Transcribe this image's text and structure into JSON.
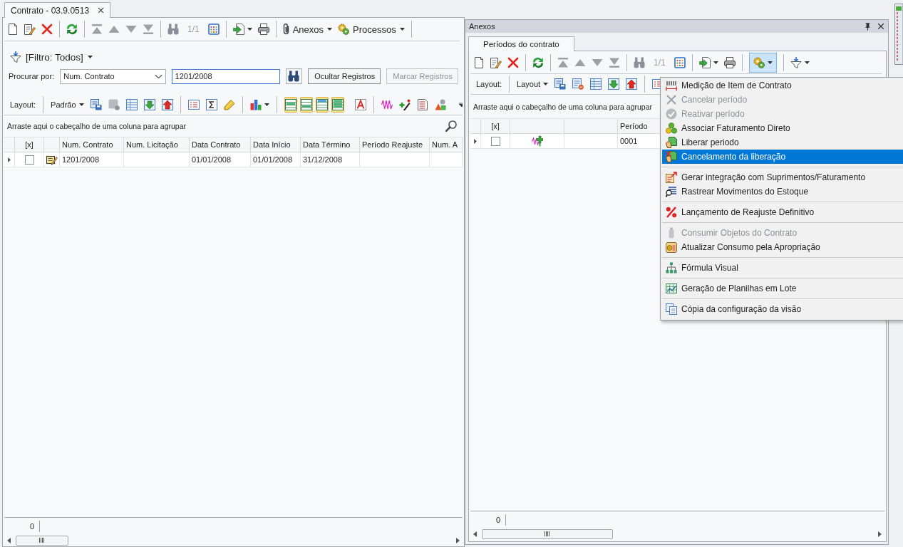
{
  "document_tab": {
    "title": "Contrato - 03.9.0513",
    "selected": true
  },
  "main": {
    "toolbar": {
      "record_counter": "1/1",
      "menus": [
        {
          "label": "Anexos"
        },
        {
          "label": "Processos"
        }
      ]
    },
    "filter": {
      "label": "[Filtro: Todos]"
    },
    "search": {
      "label": "Procurar por:",
      "field": "Num. Contrato",
      "query": "1201/2008",
      "buttons": [
        {
          "label": "Ocultar Registros",
          "disabled": false
        },
        {
          "label": "Marcar Registros",
          "disabled": true
        }
      ]
    },
    "layout_toolbar": {
      "label": "Layout:",
      "preset": "Padrão",
      "toggles": [
        {
          "on": true
        },
        {
          "on": true
        },
        {
          "on": true
        },
        {
          "on": true
        }
      ]
    },
    "grid": {
      "group_hint": "Arraste aqui o cabeçalho de uma coluna para agrupar",
      "select_header": "[x]",
      "columns": [
        "Num. Contrato",
        "Num. Licitação",
        "Data Contrato",
        "Data Início",
        "Data Término",
        "Período Reajuste",
        "Num. A"
      ],
      "rows": [
        {
          "focused": true,
          "checked": false,
          "cells": [
            "1201/2008",
            null,
            "01/01/2008",
            "01/01/2008",
            "31/12/2008",
            null,
            null
          ]
        }
      ],
      "footer_count": "0"
    }
  },
  "anexos": {
    "title": "Anexos",
    "tabs": [
      {
        "label": "Períodos do contrato",
        "selected": true
      }
    ],
    "toolbar": {
      "record_counter": "1/1",
      "processes_open": true
    },
    "layout_toolbar": {
      "label": "Layout:",
      "preset": "Layout"
    },
    "grid": {
      "group_hint": "Arraste aqui o cabeçalho de uma coluna para agrupar",
      "select_header": "[x]",
      "columns": [
        null,
        "Período"
      ],
      "rows": [
        {
          "focused": true,
          "checked": false,
          "cells": [
            null,
            "0001"
          ]
        }
      ],
      "footer_count": "0"
    }
  },
  "context_menu": {
    "groups": [
      [
        {
          "label": "Medição de Item de Contrato",
          "disabled": false,
          "selected": false
        },
        {
          "label": "Cancelar período",
          "disabled": true,
          "selected": false
        },
        {
          "label": "Reativar período",
          "disabled": true,
          "selected": false
        },
        {
          "label": "Associar Faturamento Direto",
          "disabled": false,
          "selected": false
        },
        {
          "label": "Liberar periodo",
          "disabled": false,
          "selected": false
        },
        {
          "label": "Cancelamento da liberação",
          "disabled": false,
          "selected": true
        }
      ],
      [
        {
          "label": "Gerar integração com Suprimentos/Faturamento",
          "disabled": false,
          "selected": false
        },
        {
          "label": "Rastrear Movimentos do Estoque",
          "disabled": false,
          "selected": false
        }
      ],
      [
        {
          "label": "Lançamento de Reajuste Definitivo",
          "disabled": false,
          "selected": false
        }
      ],
      [
        {
          "label": "Consumir Objetos do Contrato",
          "disabled": true,
          "selected": false
        },
        {
          "label": "Atualizar Consumo pela Apropriação",
          "disabled": false,
          "selected": false
        }
      ],
      [
        {
          "label": "Fórmula Visual",
          "disabled": false,
          "selected": false
        }
      ],
      [
        {
          "label": "Geração de Planilhas em Lote",
          "disabled": false,
          "selected": false
        }
      ],
      [
        {
          "label": "Cópia da configuração da visão",
          "disabled": false,
          "selected": false
        }
      ]
    ]
  }
}
